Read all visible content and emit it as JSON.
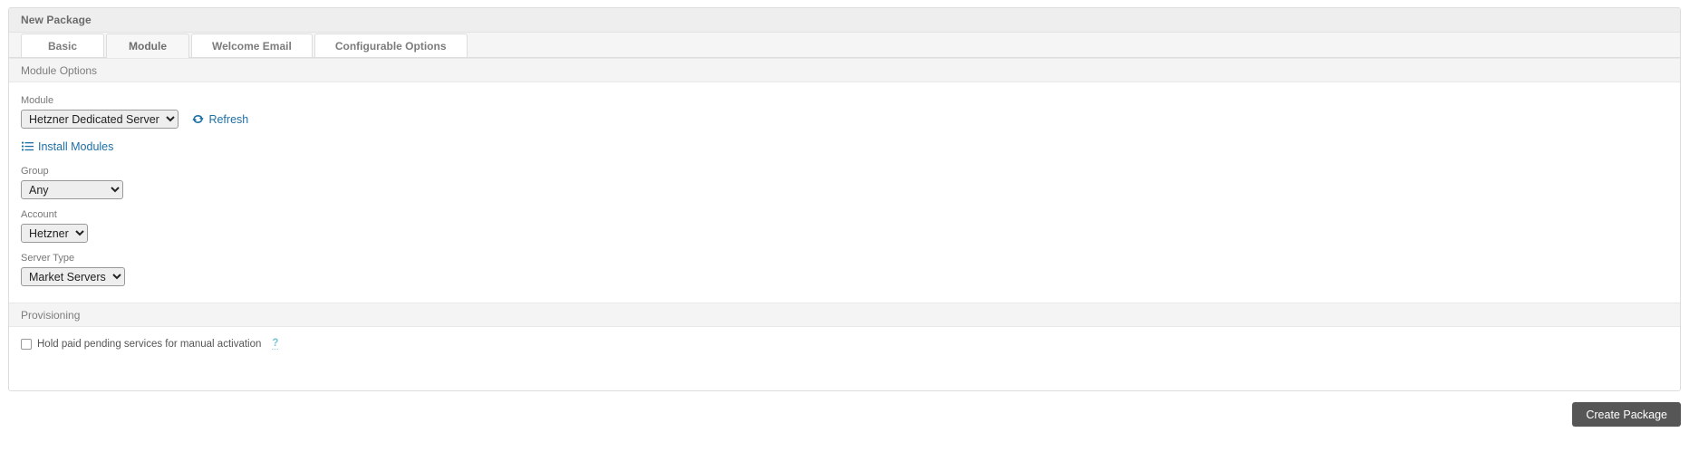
{
  "card": {
    "title": "New Package"
  },
  "tabs": [
    {
      "label": "Basic",
      "active": false
    },
    {
      "label": "Module",
      "active": true
    },
    {
      "label": "Welcome Email",
      "active": false
    },
    {
      "label": "Configurable Options",
      "active": false
    }
  ],
  "module_section": {
    "header": "Module Options",
    "module_field": {
      "label": "Module",
      "value": "Hetzner Dedicated Server",
      "options": [
        "Hetzner Dedicated Server"
      ]
    },
    "refresh_link": {
      "label": "Refresh",
      "icon": "refresh-icon"
    },
    "install_link": {
      "label": "Install Modules",
      "icon": "list-ul-icon"
    },
    "group_field": {
      "label": "Group",
      "value": "Any",
      "options": [
        "Any"
      ]
    },
    "account_field": {
      "label": "Account",
      "value": "Hetzner",
      "options": [
        "Hetzner"
      ]
    },
    "server_type_field": {
      "label": "Server Type",
      "value": "Market Servers",
      "options": [
        "Market Servers"
      ]
    }
  },
  "provisioning_section": {
    "header": "Provisioning",
    "hold_checkbox": {
      "label": "Hold paid pending services for manual activation",
      "checked": false,
      "help": "?"
    }
  },
  "footer": {
    "submit_label": "Create Package"
  },
  "colors": {
    "link": "#1d6fa5",
    "header_bg": "#eeeeee",
    "section_bg": "#f4f4f4",
    "button_bg": "#565656",
    "help_mark": "#76c5d6"
  }
}
